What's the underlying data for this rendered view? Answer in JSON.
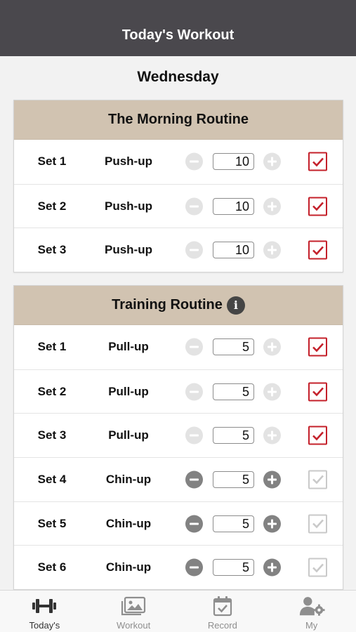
{
  "navbar": {
    "title": "Today's Workout"
  },
  "day": "Wednesday",
  "colors": {
    "accent_check": "#c4202a",
    "header_bg": "#d1c3b1",
    "navbar_bg": "#4a484d"
  },
  "routines": [
    {
      "title": "The Morning Routine",
      "has_info_icon": false,
      "sets": [
        {
          "label": "Set 1",
          "exercise": "Push-up",
          "count": "10",
          "done": true
        },
        {
          "label": "Set 2",
          "exercise": "Push-up",
          "count": "10",
          "done": true
        },
        {
          "label": "Set 3",
          "exercise": "Push-up",
          "count": "10",
          "done": true
        }
      ]
    },
    {
      "title": "Training Routine",
      "has_info_icon": true,
      "sets": [
        {
          "label": "Set 1",
          "exercise": "Pull-up",
          "count": "5",
          "done": true
        },
        {
          "label": "Set 2",
          "exercise": "Pull-up",
          "count": "5",
          "done": true
        },
        {
          "label": "Set 3",
          "exercise": "Pull-up",
          "count": "5",
          "done": true
        },
        {
          "label": "Set 4",
          "exercise": "Chin-up",
          "count": "5",
          "done": false
        },
        {
          "label": "Set 5",
          "exercise": "Chin-up",
          "count": "5",
          "done": false
        },
        {
          "label": "Set 6",
          "exercise": "Chin-up",
          "count": "5",
          "done": false
        }
      ]
    }
  ],
  "tabs": [
    {
      "label": "Today's",
      "icon": "dumbbell-icon",
      "selected": true
    },
    {
      "label": "Workout",
      "icon": "gallery-icon",
      "selected": false
    },
    {
      "label": "Record",
      "icon": "calendar-check-icon",
      "selected": false
    },
    {
      "label": "My",
      "icon": "user-gear-icon",
      "selected": false
    }
  ]
}
